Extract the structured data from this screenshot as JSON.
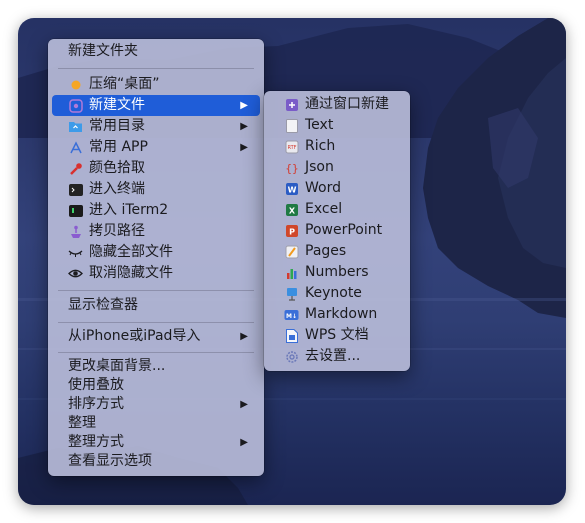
{
  "main_menu": {
    "new_folder": "新建文件夹",
    "compress": "压缩“桌面”",
    "new_file": "新建文件",
    "common_dirs": "常用目录",
    "common_apps": "常用 APP",
    "color_picker": "颜色拾取",
    "open_terminal": "进入终端",
    "open_iterm": "进入 iTerm2",
    "copy_path": "拷贝路径",
    "hide_all": "隐藏全部文件",
    "unhide_all": "取消隐藏文件",
    "show_inspector": "显示检查器",
    "import_iphone": "从iPhone或iPad导入",
    "change_background": "更改桌面背景...",
    "use_stacks": "使用叠放",
    "sort_by": "排序方式",
    "clean_up": "整理",
    "clean_up_by": "整理方式",
    "view_options": "查看显示选项",
    "submenu_arrow": "▶"
  },
  "sub_menu": {
    "via_window": "通过窗口新建",
    "text": "Text",
    "rich": "Rich",
    "json": "Json",
    "word": "Word",
    "excel": "Excel",
    "powerpoint": "PowerPoint",
    "pages": "Pages",
    "numbers": "Numbers",
    "keynote": "Keynote",
    "markdown": "Markdown",
    "wps": "WPS 文档",
    "settings": "去设置..."
  },
  "colors": {
    "selection": "#1f5dd8",
    "menu_bg": "#babeda",
    "word": "#2b5cc4",
    "excel": "#1f7a44",
    "powerpoint": "#d0472a",
    "json": "#d43a2f"
  }
}
